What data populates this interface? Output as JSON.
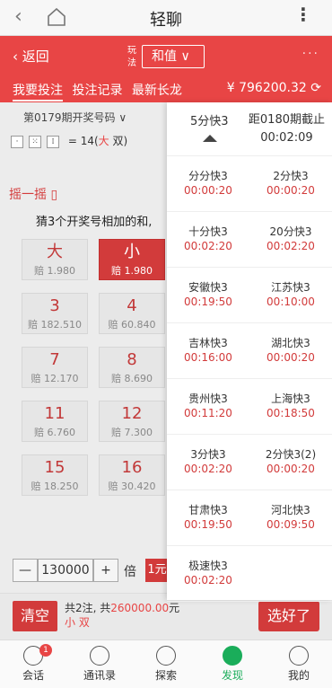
{
  "appbar": {
    "title": "轻聊",
    "back": "‹",
    "more": "⋮"
  },
  "header": {
    "return_label": "返回",
    "play_label": "玩法",
    "mode_select": "和值",
    "dots": "···",
    "tabs": [
      "我要投注",
      "投注记录",
      "最新长龙"
    ],
    "balance": "¥ 796200.32"
  },
  "left": {
    "issue": "第0179期开奖号码 ∨",
    "sum_text": "= 14(",
    "sum_big": "大",
    "sum_tail": " 双)",
    "shake": "摇一摇",
    "hint": "猜3个开奖号相加的和,",
    "cells": [
      {
        "v": "大",
        "o": "赔 1.980",
        "selected": false
      },
      {
        "v": "小",
        "o": "赔 1.980",
        "selected": true
      },
      {
        "v": "3",
        "o": "赔 182.510",
        "selected": false
      },
      {
        "v": "4",
        "o": "赔 60.840",
        "selected": false
      },
      {
        "v": "7",
        "o": "赔 12.170",
        "selected": false
      },
      {
        "v": "8",
        "o": "赔 8.690",
        "selected": false
      },
      {
        "v": "11",
        "o": "赔 6.760",
        "selected": false
      },
      {
        "v": "12",
        "o": "赔 7.300",
        "selected": false
      },
      {
        "v": "15",
        "o": "赔 18.250",
        "selected": false
      },
      {
        "v": "16",
        "o": "赔 30.420",
        "selected": false
      }
    ],
    "qty": {
      "minus": "—",
      "value": "130000",
      "plus": "+",
      "bei": "倍",
      "yuan": "1元"
    }
  },
  "action": {
    "clear": "清空",
    "summary_1": "共2注, 共",
    "summary_amount": "260000.00",
    "summary_2": "元",
    "picks": "小 双",
    "confirm": "选好了"
  },
  "panel": {
    "current_name": "5分快3",
    "deadline_label": "距0180期截止",
    "deadline_time": "00:02:09",
    "games": [
      {
        "name": "分分快3",
        "time": "00:00:20"
      },
      {
        "name": "2分快3",
        "time": "00:00:20"
      },
      {
        "name": "十分快3",
        "time": "00:02:20"
      },
      {
        "name": "20分快3",
        "time": "00:02:20"
      },
      {
        "name": "安徽快3",
        "time": "00:19:50"
      },
      {
        "name": "江苏快3",
        "time": "00:10:00"
      },
      {
        "name": "吉林快3",
        "time": "00:16:00"
      },
      {
        "name": "湖北快3",
        "time": "00:00:20"
      },
      {
        "name": "贵州快3",
        "time": "00:11:20"
      },
      {
        "name": "上海快3",
        "time": "00:18:50"
      },
      {
        "name": "3分快3",
        "time": "00:02:20"
      },
      {
        "name": "2分快3(2)",
        "time": "00:00:20"
      },
      {
        "name": "甘肃快3",
        "time": "00:19:50"
      },
      {
        "name": "河北快3",
        "time": "00:09:50"
      },
      {
        "name": "极速快3",
        "time": "00:02:20"
      }
    ]
  },
  "nav": {
    "items": [
      {
        "label": "会话",
        "badge": "1"
      },
      {
        "label": "通讯录"
      },
      {
        "label": "探索"
      },
      {
        "label": "发现"
      },
      {
        "label": "我的"
      }
    ]
  },
  "colors": {
    "accent": "#e84545",
    "selected": "#d23b3b",
    "nav_active": "#1aad5a"
  }
}
